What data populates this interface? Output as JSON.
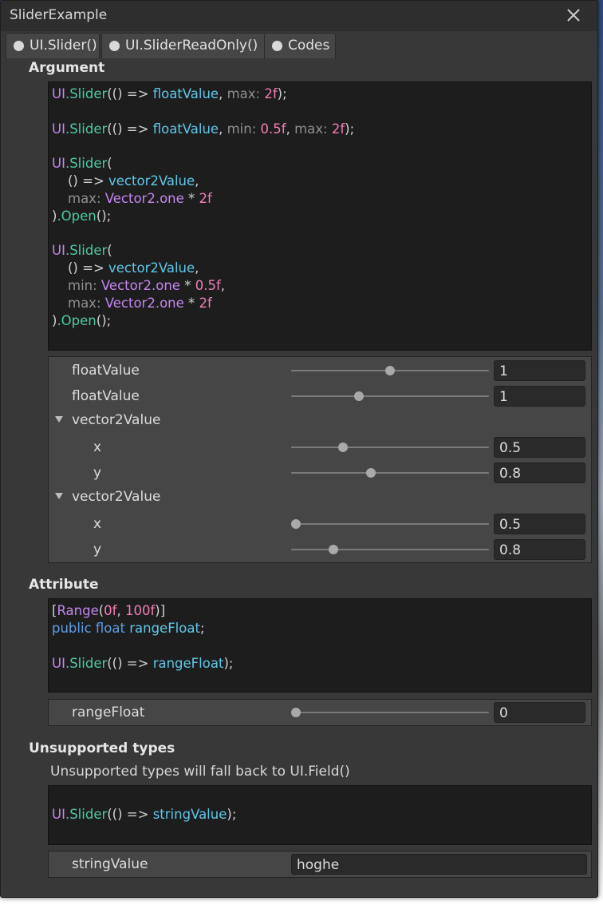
{
  "window": {
    "title": "SliderExample"
  },
  "tabs": [
    {
      "label": "UI.Slider()"
    },
    {
      "label": "UI.SliderReadOnly()"
    },
    {
      "label": "Codes"
    }
  ],
  "sections": {
    "argument": "Argument",
    "attribute": "Attribute",
    "unsupported": "Unsupported types",
    "unsupported_note": "Unsupported types will fall back to UI.Field()"
  },
  "argument_code": {
    "l1": [
      "UI",
      ".Slider",
      "(() => ",
      "floatValue",
      ", ",
      "max: ",
      "2f",
      ");"
    ],
    "l2": [
      "UI",
      ".Slider",
      "(() => ",
      "floatValue",
      ", ",
      "min: ",
      "0.5f",
      ", ",
      "max: ",
      "2f",
      ");"
    ],
    "l3": [
      "UI",
      ".Slider",
      "("
    ],
    "l4": [
      "() => ",
      "vector2Value",
      ","
    ],
    "l5": [
      "max: ",
      "Vector2",
      ".one",
      " * ",
      "2f"
    ],
    "l6": [
      ")",
      ".Open",
      "();"
    ],
    "l7": [
      "UI",
      ".Slider",
      "("
    ],
    "l8": [
      "() => ",
      "vector2Value",
      ","
    ],
    "l9": [
      "min: ",
      "Vector2",
      ".one",
      " * ",
      "0.5f",
      ","
    ],
    "l10": [
      "max: ",
      "Vector2",
      ".one",
      " * ",
      "2f"
    ],
    "l11": [
      ")",
      ".Open",
      "();"
    ]
  },
  "argument_rows": [
    {
      "label": "floatValue",
      "value": "1",
      "slider_fraction": 0.5
    },
    {
      "label": "floatValue",
      "value": "1",
      "slider_fraction": 0.3333
    },
    {
      "label": "vector2Value",
      "foldout": "expanded"
    },
    {
      "label": "x",
      "value": "0.5",
      "slider_fraction": 0.25
    },
    {
      "label": "y",
      "value": "0.8",
      "slider_fraction": 0.4
    },
    {
      "label": "vector2Value",
      "foldout": "expanded"
    },
    {
      "label": "x",
      "value": "0.5",
      "slider_fraction": 0.0
    },
    {
      "label": "y",
      "value": "0.8",
      "slider_fraction": 0.2
    }
  ],
  "attribute_code": {
    "l1": [
      "[",
      "Range",
      "(",
      "0f",
      ", ",
      "100f",
      ")]"
    ],
    "l2": [
      "public float ",
      "rangeFloat",
      ";"
    ],
    "l3": [
      "UI",
      ".Slider",
      "(() => ",
      "rangeFloat",
      ");"
    ]
  },
  "attribute_row": {
    "label": "rangeFloat",
    "value": "0",
    "slider_fraction": 0.0
  },
  "unsupported_code": {
    "l1": [
      "UI",
      ".Slider",
      "(() => ",
      "stringValue",
      ");"
    ]
  },
  "unsupported_row": {
    "label": "stringValue",
    "value": "hoghe"
  },
  "colors": {
    "window_bg": "#383838",
    "code_bg": "#1d1d1d",
    "type_color": "#c586f0",
    "method_color": "#4ec9a4",
    "variable_color": "#5fc8ea",
    "number_color": "#f27fb6",
    "keyword_color": "#5b9fe6"
  }
}
